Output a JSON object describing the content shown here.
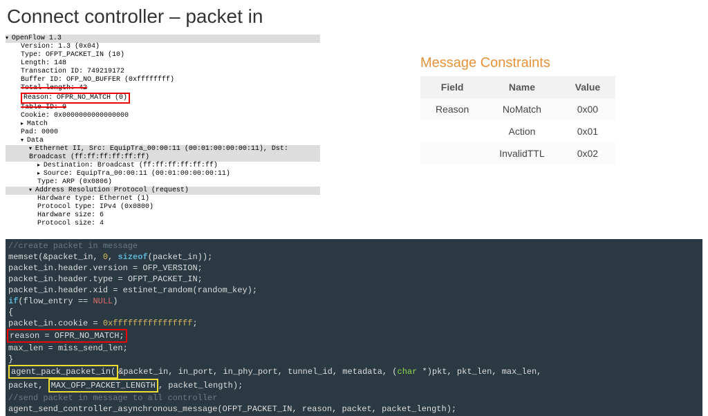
{
  "title": "Connect controller – packet in",
  "packet": {
    "root": "OpenFlow 1.3",
    "lines": {
      "version": "Version: 1.3 (0x04)",
      "type": "Type: OFPT_PACKET_IN (10)",
      "length": "Length: 148",
      "txid": "Transaction ID: 749219172",
      "buffer": "Buffer ID: OFP_NO_BUFFER (0xffffffff)",
      "totlen": "Total length: 42",
      "reason": "Reason: OFPR_NO_MATCH (0)",
      "table": "Table ID: 0",
      "cookie": "Cookie: 0x0000000000000000",
      "match": "Match",
      "pad": "Pad: 0000",
      "data": "Data",
      "eth": "Ethernet II, Src: EquipTra_00:00:11 (00:01:00:00:00:11), Dst: Broadcast (ff:ff:ff:ff:ff:ff)",
      "dst": "Destination: Broadcast (ff:ff:ff:ff:ff:ff)",
      "src": "Source: EquipTra_00:00:11 (00:01:00:00:00:11)",
      "ethtype": "Type: ARP (0x0806)",
      "arp": "Address Resolution Protocol (request)",
      "hwtype": "Hardware type: Ethernet (1)",
      "prototype": "Protocol type: IPv4 (0x0800)",
      "hwsize": "Hardware size: 6",
      "psize": "Protocol size: 4"
    }
  },
  "mc": {
    "title": "Message Constraints",
    "headers": {
      "field": "Field",
      "name": "Name",
      "value": "Value"
    },
    "rows": [
      {
        "field": "Reason",
        "name": "NoMatch",
        "value": "0x00"
      },
      {
        "field": "",
        "name": "Action",
        "value": "0x01"
      },
      {
        "field": "",
        "name": "InvalidTTL",
        "value": "0x02"
      }
    ]
  },
  "code": {
    "c0": "//create packet in message",
    "c1a": "memset(&packet_in, ",
    "c1b": "0",
    "c1c": ", ",
    "c1d": "sizeof",
    "c1e": "(packet_in));",
    "c2": "packet_in.header.version      = OFP_VERSION;",
    "c3": "packet_in.header.type         = OFPT_PACKET_IN;",
    "c4": "packet_in.header.xid          = estinet_random(random_key);",
    "c5a": "if",
    "c5b": "(flow_entry == ",
    "c5c": "NULL",
    "c5d": ")",
    "c6": "{",
    "c7a": "       packet_in.cookie      = ",
    "c7b": "0xffffffffffffffff",
    "c7c": ";",
    "c8": "       reason                = OFPR_NO_MATCH;",
    "c9": "       max_len               = miss_send_len;",
    "c10": "}",
    "c11a": "       ",
    "c11b": "agent_pack_packet_in(",
    "c11c": "&packet_in, in_port, in_phy_port, tunnel_id, metadata, (",
    "c11d": "char",
    "c11e": " *)pkt, pkt_len, max_len,",
    "c12a": "packet, ",
    "c12b": "MAX_OFP_PACKET_LENGTH",
    "c12c": ", packet_length);",
    "c13": "       //send packet in message to all controller",
    "c14": "       agent_send_controller_asynchronous_message(OFPT_PACKET_IN, reason, packet, packet_length);"
  }
}
